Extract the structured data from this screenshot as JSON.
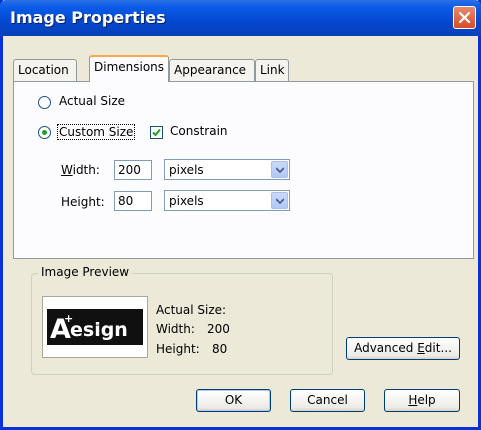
{
  "window": {
    "title": "Image Properties"
  },
  "tabs": [
    {
      "label": "Location",
      "active": false
    },
    {
      "label": "Dimensions",
      "active": true
    },
    {
      "label": "Appearance",
      "active": false
    },
    {
      "label": "Link",
      "active": false
    }
  ],
  "dimensions": {
    "actual_size_label": "Actual Size",
    "custom_size_label": "Custom Size",
    "constrain_label": "Constrain",
    "selected_option": "Custom Size",
    "constrain_checked": true,
    "width_label_underline": "W",
    "width_label_rest": "idth:",
    "width_value": "200",
    "width_unit": "pixels",
    "height_label": "Height:",
    "height_value": "80",
    "height_unit": "pixels"
  },
  "preview": {
    "legend": "Image Preview",
    "logo_text": "esign",
    "logo_letter": "A",
    "info_title": "Actual Size:",
    "width_label": "Width:",
    "width_value": "200",
    "height_label": "Height:",
    "height_value": "80"
  },
  "buttons": {
    "advanced_edit_pre": "Advanced ",
    "advanced_edit_underline": "E",
    "advanced_edit_post": "dit...",
    "ok": "OK",
    "cancel": "Cancel",
    "help_underline": "H",
    "help_rest": "elp"
  },
  "colors": {
    "titlebar": "#0447d0",
    "close_button": "#d64b26",
    "active_tab_highlight": "#f5a94a",
    "check_green": "#21a121"
  },
  "icons": [
    "close-icon",
    "radio-unselected-icon",
    "radio-selected-icon",
    "checkbox-checked-icon",
    "dropdown-arrow-icon",
    "design-logo-image"
  ]
}
